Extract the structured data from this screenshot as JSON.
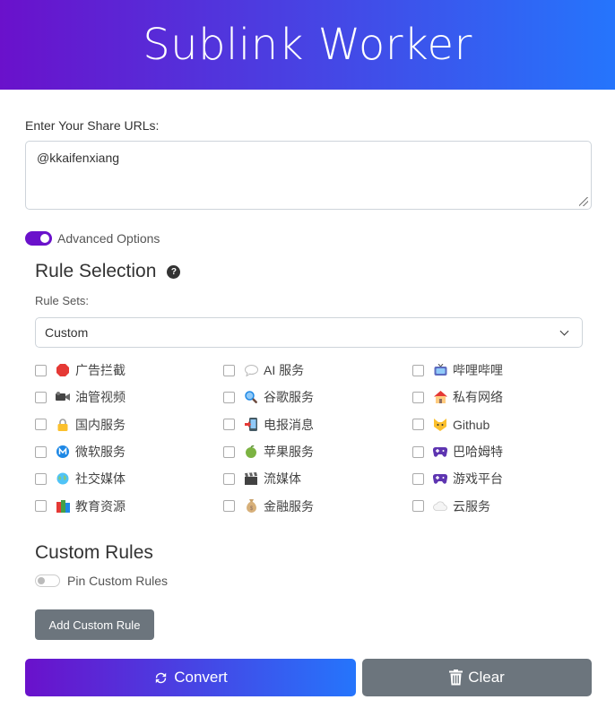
{
  "header": {
    "title": "Sublink Worker"
  },
  "urls": {
    "label": "Enter Your Share URLs:",
    "value": "@kkaifenxiang"
  },
  "advanced": {
    "label": "Advanced Options",
    "enabled": true
  },
  "rule_selection": {
    "title": "Rule Selection",
    "help_icon": "question-circle-icon",
    "rulesets_label": "Rule Sets:",
    "selected": "Custom",
    "rules": [
      {
        "label": "广告拦截",
        "icon": "stop-sign"
      },
      {
        "label": "AI 服务",
        "icon": "speech-bubble"
      },
      {
        "label": "哔哩哔哩",
        "icon": "tv"
      },
      {
        "label": "油管视频",
        "icon": "video-camera"
      },
      {
        "label": "谷歌服务",
        "icon": "magnifier"
      },
      {
        "label": "私有网络",
        "icon": "house"
      },
      {
        "label": "国内服务",
        "icon": "lock"
      },
      {
        "label": "电报消息",
        "icon": "phone-arrow"
      },
      {
        "label": "Github",
        "icon": "cat"
      },
      {
        "label": "微软服务",
        "icon": "m-circle"
      },
      {
        "label": "苹果服务",
        "icon": "apple"
      },
      {
        "label": "巴哈姆特",
        "icon": "game-controller"
      },
      {
        "label": "社交媒体",
        "icon": "globe"
      },
      {
        "label": "流媒体",
        "icon": "clapper"
      },
      {
        "label": "游戏平台",
        "icon": "game-controller"
      },
      {
        "label": "教育资源",
        "icon": "books"
      },
      {
        "label": "金融服务",
        "icon": "money-bag"
      },
      {
        "label": "云服务",
        "icon": "cloud"
      }
    ]
  },
  "custom_rules": {
    "title": "Custom Rules",
    "pin_label": "Pin Custom Rules",
    "pin_enabled": false,
    "add_button": "Add Custom Rule"
  },
  "actions": {
    "convert": "Convert",
    "clear": "Clear"
  },
  "colors": {
    "gradient_start": "#6a11cb",
    "gradient_end": "#2575fc",
    "secondary": "#6c757d"
  }
}
